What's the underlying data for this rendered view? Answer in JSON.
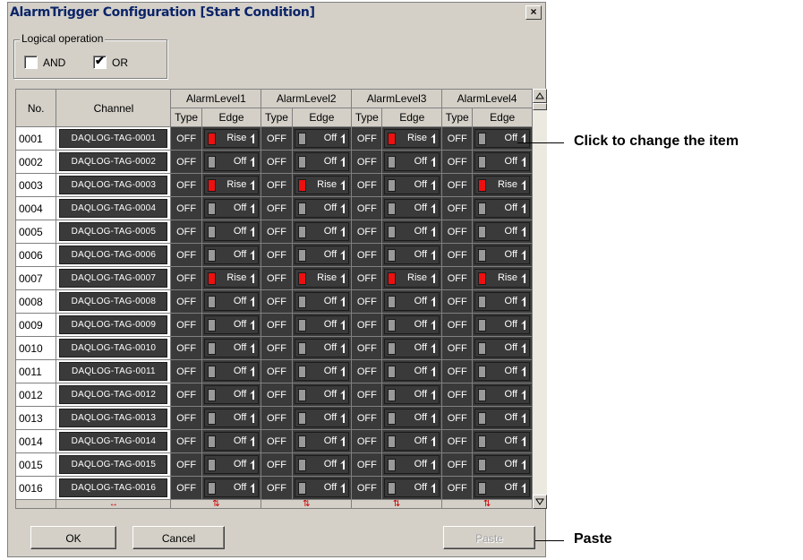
{
  "window": {
    "title": "AlarmTrigger Configuration [Start Condition]",
    "close_label": "×"
  },
  "logical_operation": {
    "legend": "Logical operation",
    "and_label": "AND",
    "and_checked": false,
    "or_label": "OR",
    "or_checked": true
  },
  "table": {
    "col_no": "No.",
    "col_channel": "Channel",
    "col_type": "Type",
    "col_edge": "Edge",
    "alarm_levels": [
      "AlarmLevel1",
      "AlarmLevel2",
      "AlarmLevel3",
      "AlarmLevel4"
    ],
    "footer_marks": [
      "↔",
      "⇅",
      "⇅",
      "⇅",
      "⇅"
    ],
    "rows": [
      {
        "no": "0001",
        "channel": "DAQLOG-TAG-0001",
        "levels": [
          {
            "type": "OFF",
            "edge": "Rise",
            "on": true
          },
          {
            "type": "OFF",
            "edge": "Off",
            "on": false
          },
          {
            "type": "OFF",
            "edge": "Rise",
            "on": true
          },
          {
            "type": "OFF",
            "edge": "Off",
            "on": false
          }
        ]
      },
      {
        "no": "0002",
        "channel": "DAQLOG-TAG-0002",
        "levels": [
          {
            "type": "OFF",
            "edge": "Off",
            "on": false
          },
          {
            "type": "OFF",
            "edge": "Off",
            "on": false
          },
          {
            "type": "OFF",
            "edge": "Off",
            "on": false
          },
          {
            "type": "OFF",
            "edge": "Off",
            "on": false
          }
        ]
      },
      {
        "no": "0003",
        "channel": "DAQLOG-TAG-0003",
        "levels": [
          {
            "type": "OFF",
            "edge": "Rise",
            "on": true
          },
          {
            "type": "OFF",
            "edge": "Rise",
            "on": true
          },
          {
            "type": "OFF",
            "edge": "Off",
            "on": false
          },
          {
            "type": "OFF",
            "edge": "Rise",
            "on": true
          }
        ]
      },
      {
        "no": "0004",
        "channel": "DAQLOG-TAG-0004",
        "levels": [
          {
            "type": "OFF",
            "edge": "Off",
            "on": false
          },
          {
            "type": "OFF",
            "edge": "Off",
            "on": false
          },
          {
            "type": "OFF",
            "edge": "Off",
            "on": false
          },
          {
            "type": "OFF",
            "edge": "Off",
            "on": false
          }
        ]
      },
      {
        "no": "0005",
        "channel": "DAQLOG-TAG-0005",
        "levels": [
          {
            "type": "OFF",
            "edge": "Off",
            "on": false
          },
          {
            "type": "OFF",
            "edge": "Off",
            "on": false
          },
          {
            "type": "OFF",
            "edge": "Off",
            "on": false
          },
          {
            "type": "OFF",
            "edge": "Off",
            "on": false
          }
        ]
      },
      {
        "no": "0006",
        "channel": "DAQLOG-TAG-0006",
        "levels": [
          {
            "type": "OFF",
            "edge": "Off",
            "on": false
          },
          {
            "type": "OFF",
            "edge": "Off",
            "on": false
          },
          {
            "type": "OFF",
            "edge": "Off",
            "on": false
          },
          {
            "type": "OFF",
            "edge": "Off",
            "on": false
          }
        ]
      },
      {
        "no": "0007",
        "channel": "DAQLOG-TAG-0007",
        "levels": [
          {
            "type": "OFF",
            "edge": "Rise",
            "on": true
          },
          {
            "type": "OFF",
            "edge": "Rise",
            "on": true
          },
          {
            "type": "OFF",
            "edge": "Rise",
            "on": true
          },
          {
            "type": "OFF",
            "edge": "Rise",
            "on": true
          }
        ]
      },
      {
        "no": "0008",
        "channel": "DAQLOG-TAG-0008",
        "levels": [
          {
            "type": "OFF",
            "edge": "Off",
            "on": false
          },
          {
            "type": "OFF",
            "edge": "Off",
            "on": false
          },
          {
            "type": "OFF",
            "edge": "Off",
            "on": false
          },
          {
            "type": "OFF",
            "edge": "Off",
            "on": false
          }
        ]
      },
      {
        "no": "0009",
        "channel": "DAQLOG-TAG-0009",
        "levels": [
          {
            "type": "OFF",
            "edge": "Off",
            "on": false
          },
          {
            "type": "OFF",
            "edge": "Off",
            "on": false
          },
          {
            "type": "OFF",
            "edge": "Off",
            "on": false
          },
          {
            "type": "OFF",
            "edge": "Off",
            "on": false
          }
        ]
      },
      {
        "no": "0010",
        "channel": "DAQLOG-TAG-0010",
        "levels": [
          {
            "type": "OFF",
            "edge": "Off",
            "on": false
          },
          {
            "type": "OFF",
            "edge": "Off",
            "on": false
          },
          {
            "type": "OFF",
            "edge": "Off",
            "on": false
          },
          {
            "type": "OFF",
            "edge": "Off",
            "on": false
          }
        ]
      },
      {
        "no": "0011",
        "channel": "DAQLOG-TAG-0011",
        "levels": [
          {
            "type": "OFF",
            "edge": "Off",
            "on": false
          },
          {
            "type": "OFF",
            "edge": "Off",
            "on": false
          },
          {
            "type": "OFF",
            "edge": "Off",
            "on": false
          },
          {
            "type": "OFF",
            "edge": "Off",
            "on": false
          }
        ]
      },
      {
        "no": "0012",
        "channel": "DAQLOG-TAG-0012",
        "levels": [
          {
            "type": "OFF",
            "edge": "Off",
            "on": false
          },
          {
            "type": "OFF",
            "edge": "Off",
            "on": false
          },
          {
            "type": "OFF",
            "edge": "Off",
            "on": false
          },
          {
            "type": "OFF",
            "edge": "Off",
            "on": false
          }
        ]
      },
      {
        "no": "0013",
        "channel": "DAQLOG-TAG-0013",
        "levels": [
          {
            "type": "OFF",
            "edge": "Off",
            "on": false
          },
          {
            "type": "OFF",
            "edge": "Off",
            "on": false
          },
          {
            "type": "OFF",
            "edge": "Off",
            "on": false
          },
          {
            "type": "OFF",
            "edge": "Off",
            "on": false
          }
        ]
      },
      {
        "no": "0014",
        "channel": "DAQLOG-TAG-0014",
        "levels": [
          {
            "type": "OFF",
            "edge": "Off",
            "on": false
          },
          {
            "type": "OFF",
            "edge": "Off",
            "on": false
          },
          {
            "type": "OFF",
            "edge": "Off",
            "on": false
          },
          {
            "type": "OFF",
            "edge": "Off",
            "on": false
          }
        ]
      },
      {
        "no": "0015",
        "channel": "DAQLOG-TAG-0015",
        "levels": [
          {
            "type": "OFF",
            "edge": "Off",
            "on": false
          },
          {
            "type": "OFF",
            "edge": "Off",
            "on": false
          },
          {
            "type": "OFF",
            "edge": "Off",
            "on": false
          },
          {
            "type": "OFF",
            "edge": "Off",
            "on": false
          }
        ]
      },
      {
        "no": "0016",
        "channel": "DAQLOG-TAG-0016",
        "levels": [
          {
            "type": "OFF",
            "edge": "Off",
            "on": false
          },
          {
            "type": "OFF",
            "edge": "Off",
            "on": false
          },
          {
            "type": "OFF",
            "edge": "Off",
            "on": false
          },
          {
            "type": "OFF",
            "edge": "Off",
            "on": false
          }
        ]
      }
    ]
  },
  "buttons": {
    "ok": "OK",
    "cancel": "Cancel",
    "paste": "Paste"
  },
  "callouts": {
    "click_to_change": "Click to change the item",
    "paste": "Paste"
  },
  "colors": {
    "led_on": "#ee1010",
    "led_off": "#9a9a9a",
    "cell_dark": "#3a3a3a",
    "title_text": "#0a2468",
    "dialog_bg": "#d4d0c8"
  },
  "icons": {
    "edge_arrow": "edge-arrow-icon",
    "scroll_up": "scroll-up-icon",
    "scroll_down": "scroll-down-icon",
    "checkmark": "checkmark-icon"
  }
}
